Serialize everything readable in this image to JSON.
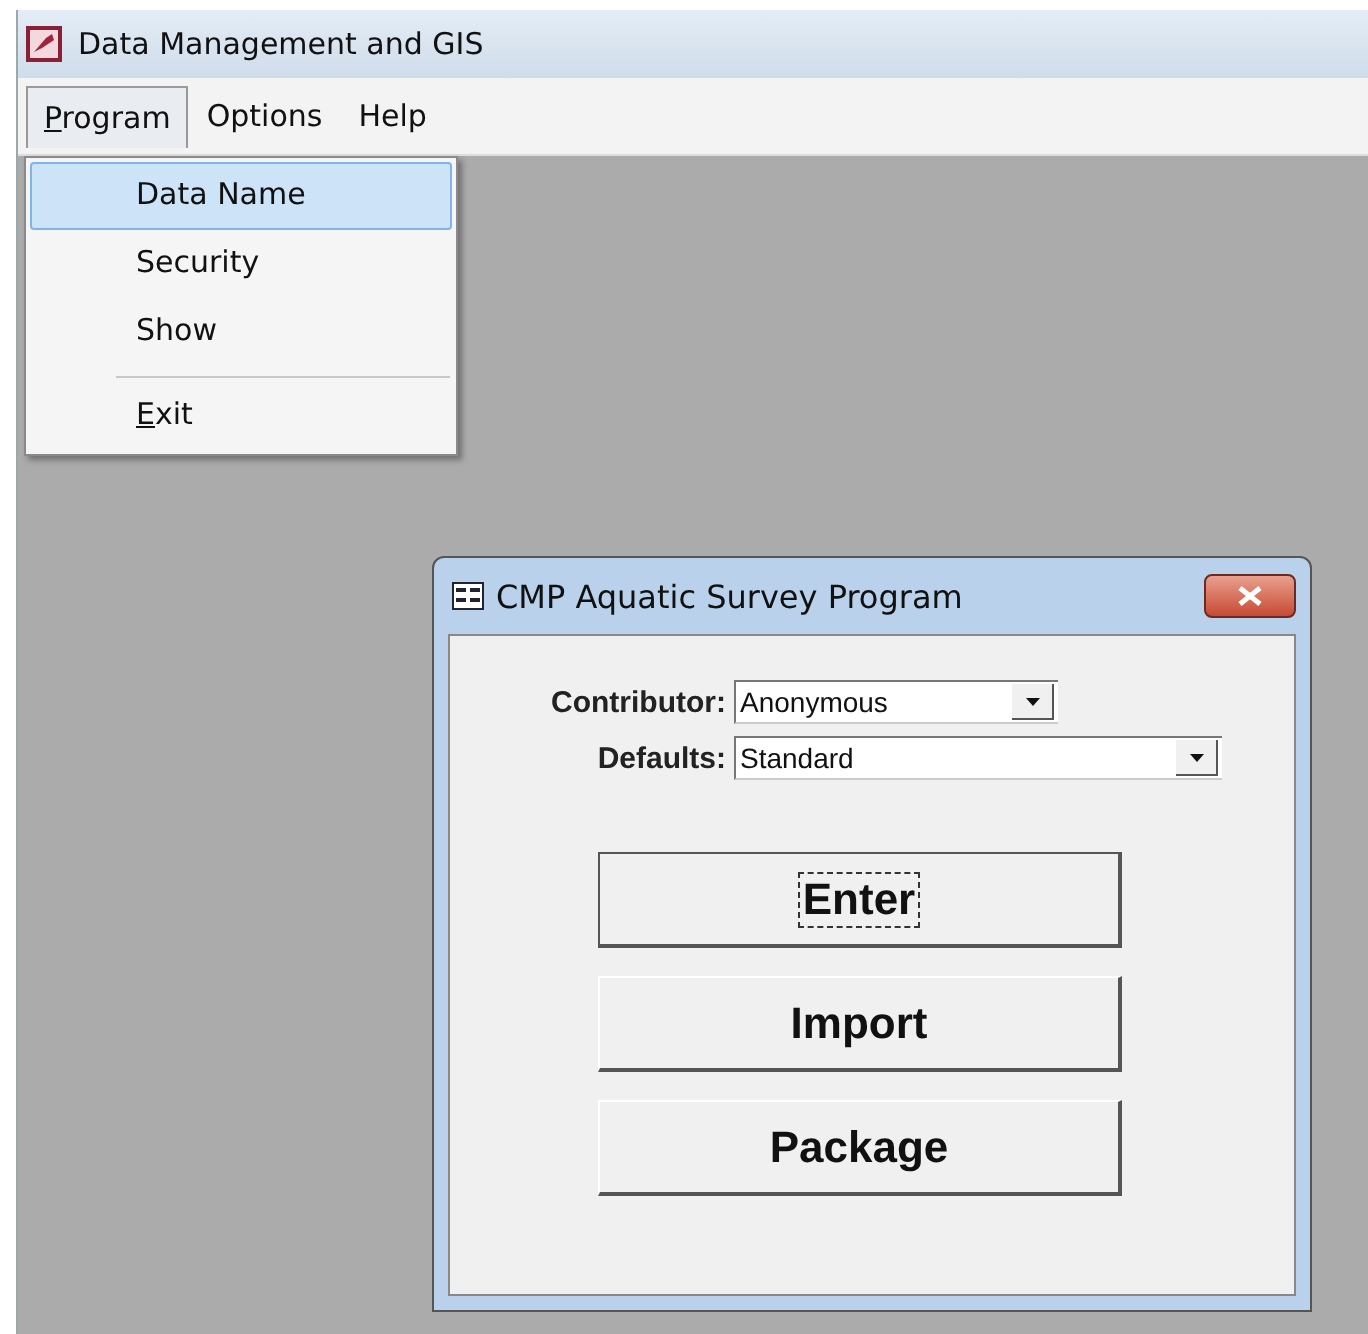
{
  "window": {
    "title": "Data Management and GIS"
  },
  "menu_bar": [
    {
      "label": "Program",
      "open": true,
      "mnemonic_first": true
    },
    {
      "label": "Options",
      "open": false,
      "mnemonic_first": false
    },
    {
      "label": "Help",
      "open": false,
      "mnemonic_first": false
    }
  ],
  "program_menu": [
    {
      "label": "Data  Name",
      "selected": true,
      "separator_before": false,
      "mnemonic_first": false
    },
    {
      "label": "Security",
      "selected": false,
      "separator_before": false,
      "mnemonic_first": false
    },
    {
      "label": "Show",
      "selected": false,
      "separator_before": false,
      "mnemonic_first": false
    },
    {
      "label": "Exit",
      "selected": false,
      "separator_before": true,
      "mnemonic_first": true
    }
  ],
  "dialog": {
    "title": "CMP Aquatic Survey Program",
    "fields": [
      {
        "label": "Contributor:",
        "value": "Anonymous",
        "kind": "short"
      },
      {
        "label": "Defaults:",
        "value": "Standard",
        "kind": "wide"
      }
    ],
    "buttons": [
      {
        "label": "Enter",
        "focused": true
      },
      {
        "label": "Import",
        "focused": false
      },
      {
        "label": "Package",
        "focused": false
      }
    ]
  }
}
